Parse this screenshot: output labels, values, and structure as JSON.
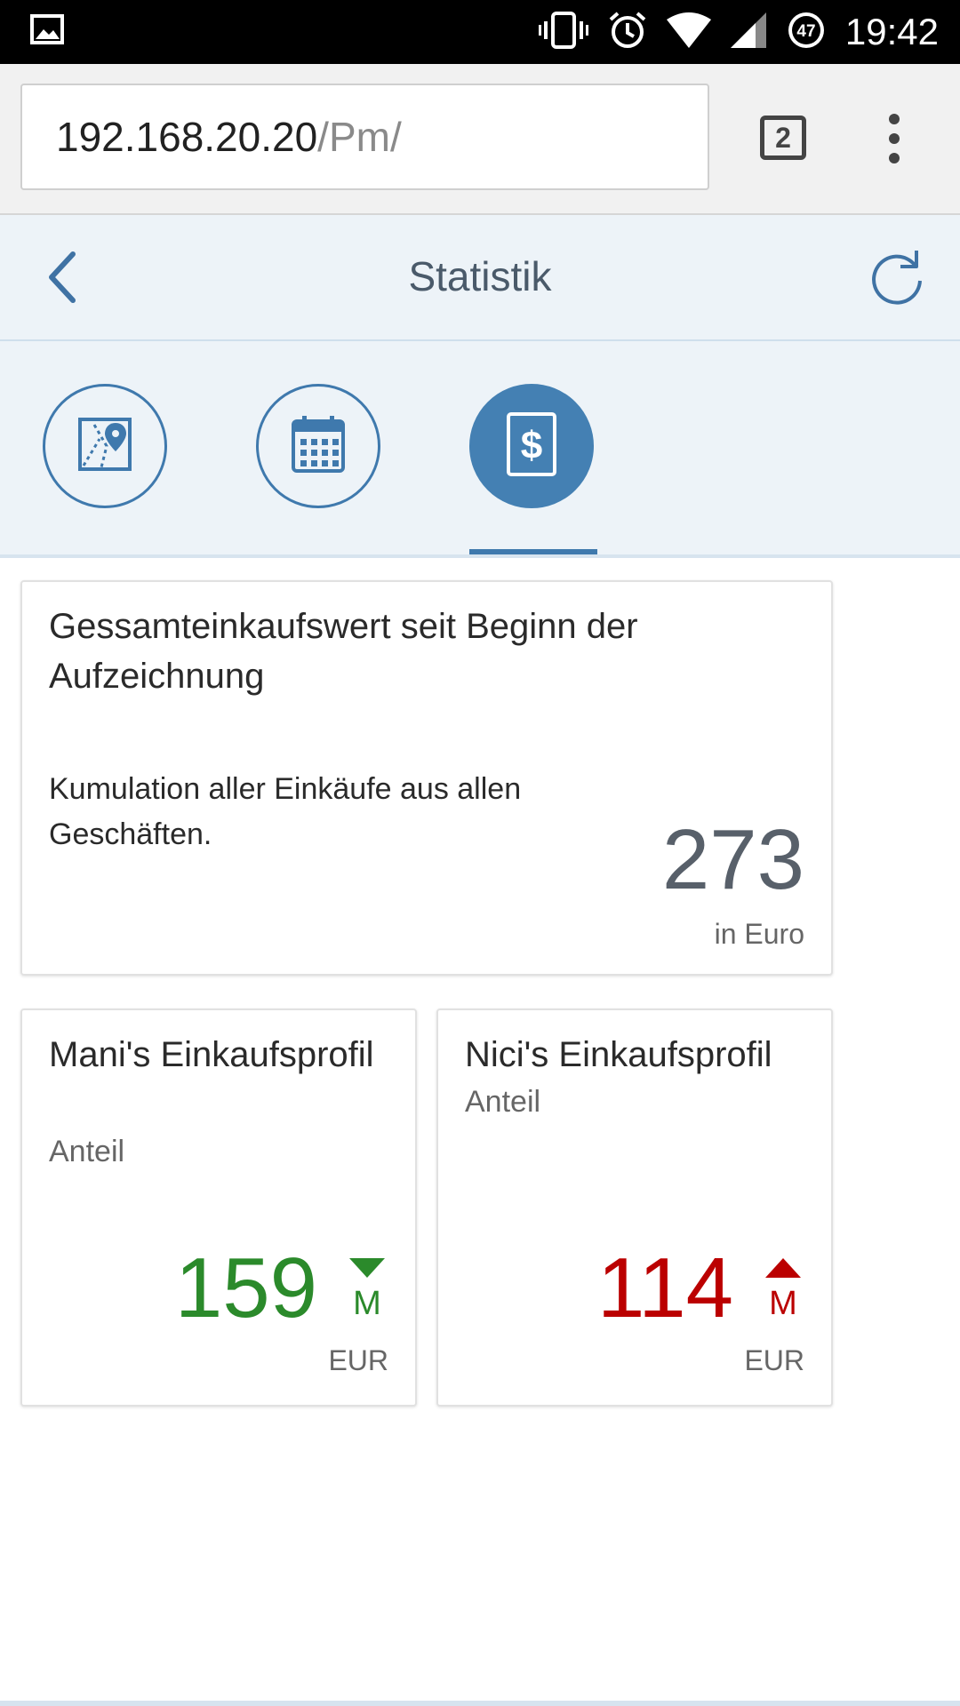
{
  "status_bar": {
    "time": "19:42",
    "battery_level": "47",
    "icons": [
      "image-icon",
      "vibrate-icon",
      "alarm-icon",
      "wifi-icon",
      "signal-icon",
      "battery-icon"
    ]
  },
  "browser": {
    "url_host": "192.168.20.20",
    "url_path": "/Pm/",
    "tab_count": "2"
  },
  "header": {
    "title": "Statistik",
    "back_icon": "chevron-left-icon",
    "refresh_icon": "refresh-icon"
  },
  "tabs": [
    {
      "icon": "map-pin-icon",
      "active": false
    },
    {
      "icon": "calendar-icon",
      "active": false
    },
    {
      "icon": "dollar-icon",
      "active": true
    }
  ],
  "total_card": {
    "title": "Gessamteinkaufswert seit Beginn der Aufzeichnung",
    "description": "Kumulation aller Einkäufe aus allen Geschäften.",
    "value": "273",
    "unit": "in Euro"
  },
  "profiles": [
    {
      "title": "Mani's Einkaufsprofil",
      "subtitle": "Anteil",
      "value": "159",
      "scale": "M",
      "trend": "down",
      "unit": "EUR",
      "color": "#2b8a2b"
    },
    {
      "title": "Nici's Einkaufsprofil",
      "subtitle": "Anteil",
      "value": "114",
      "scale": "M",
      "trend": "up",
      "unit": "EUR",
      "color": "#bb0000"
    }
  ]
}
